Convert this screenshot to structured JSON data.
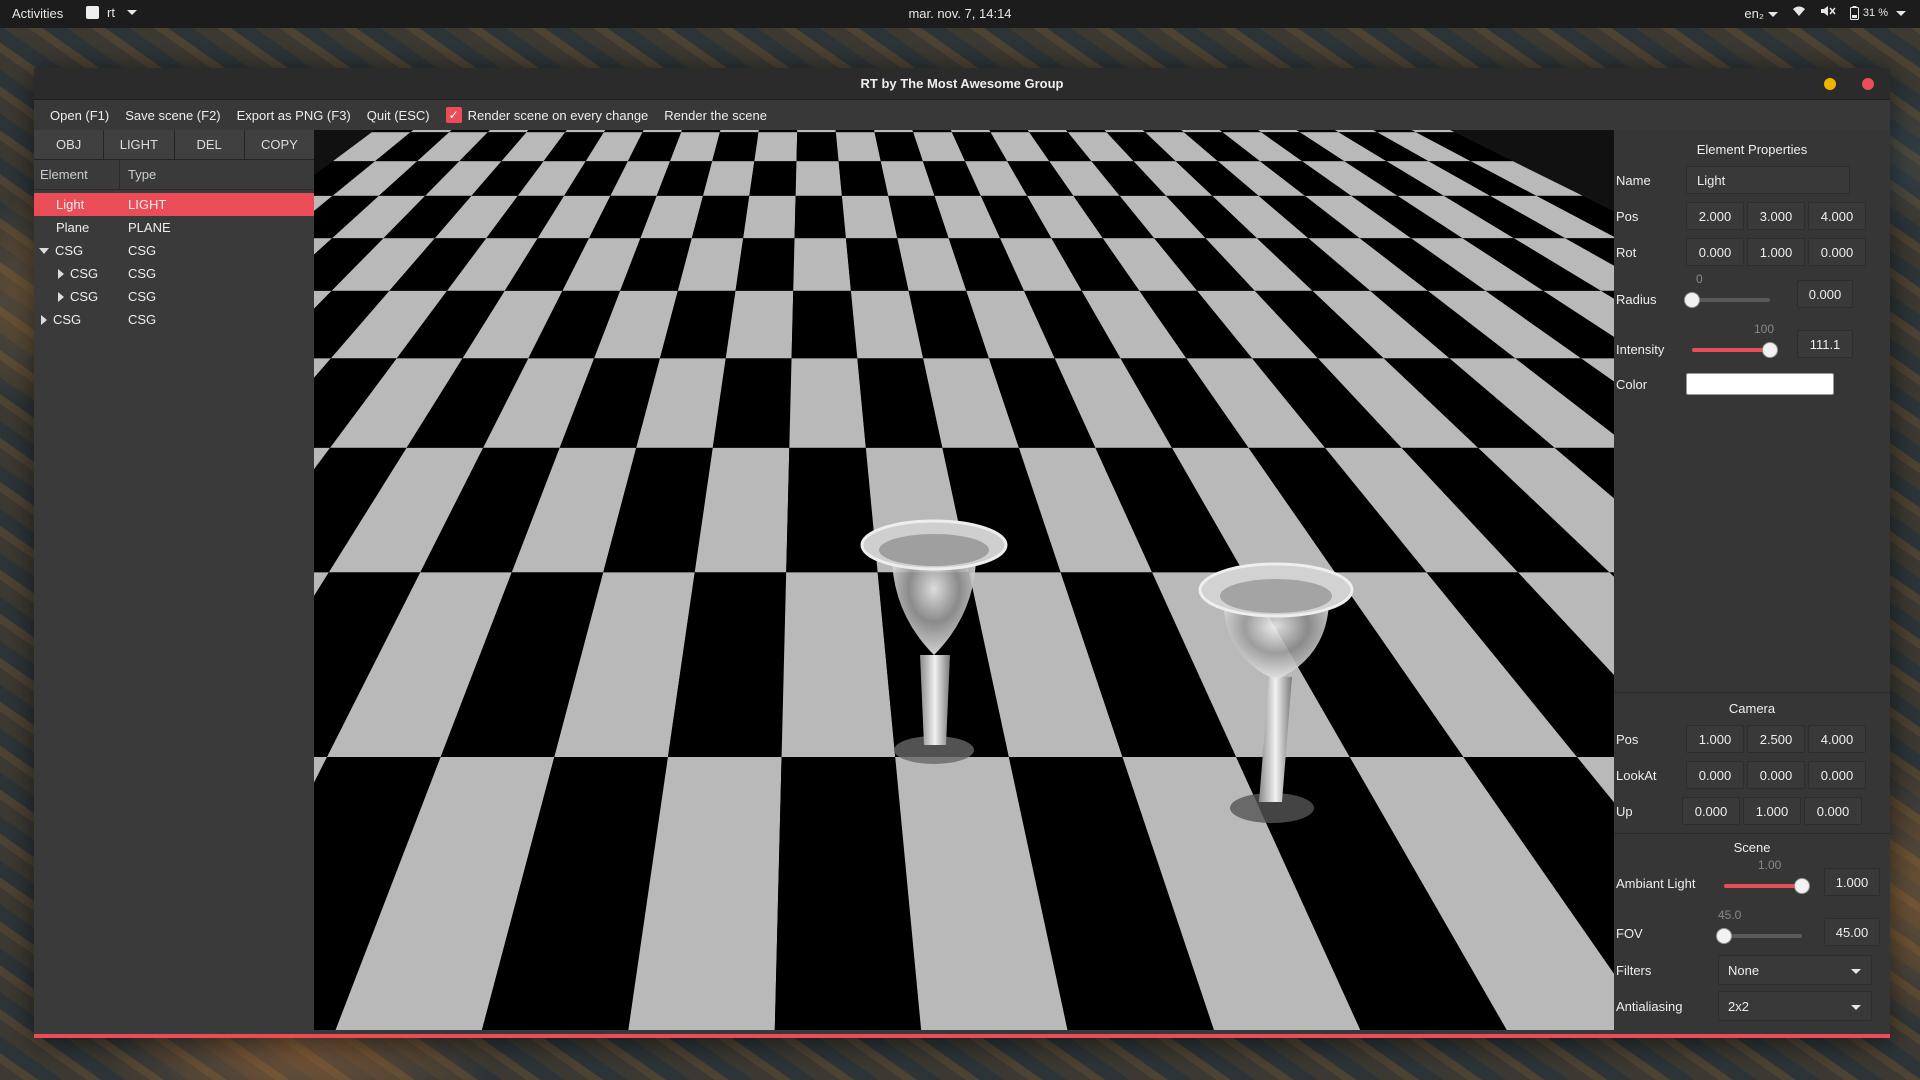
{
  "topbar": {
    "activities": "Activities",
    "app": "rt",
    "clock": "mar. nov.  7, 14:14",
    "lang": "en₂",
    "battery": "31 %"
  },
  "window": {
    "title": "RT by The Most Awesome Group"
  },
  "menu": {
    "open": "Open (F1)",
    "save": "Save scene (F2)",
    "export": "Export as PNG (F3)",
    "quit": "Quit (ESC)",
    "render_on_change": "Render scene on every change",
    "render_on_change_checked": true,
    "render": "Render the scene"
  },
  "left": {
    "tabs": [
      "OBJ",
      "LIGHT",
      "DEL",
      "COPY"
    ],
    "headers": {
      "element": "Element",
      "type": "Type"
    },
    "rows": [
      {
        "element": "Light",
        "type": "LIGHT"
      },
      {
        "element": "Plane",
        "type": "PLANE"
      },
      {
        "element": "CSG",
        "type": "CSG"
      },
      {
        "element": "CSG",
        "type": "CSG"
      },
      {
        "element": "CSG",
        "type": "CSG"
      },
      {
        "element": "CSG",
        "type": "CSG"
      }
    ]
  },
  "properties": {
    "title": "Element Properties",
    "name_label": "Name",
    "name_value": "Light",
    "pos_label": "Pos",
    "pos": [
      "2.000",
      "3.000",
      "4.000"
    ],
    "rot_label": "Rot",
    "rot": [
      "0.000",
      "1.000",
      "0.000"
    ],
    "radius_label": "Radius",
    "radius_slider_text": "0",
    "radius_value": "0.000",
    "radius_level": 0,
    "intensity_label": "Intensity",
    "intensity_slider_text": "100",
    "intensity_value": "111.1",
    "intensity_level": 1,
    "color_label": "Color",
    "color_value": "#ffffff"
  },
  "camera": {
    "title": "Camera",
    "pos_label": "Pos",
    "pos": [
      "1.000",
      "2.500",
      "4.000"
    ],
    "lookat_label": "LookAt",
    "lookat": [
      "0.000",
      "0.000",
      "0.000"
    ],
    "up_label": "Up",
    "up": [
      "0.000",
      "1.000",
      "0.000"
    ]
  },
  "scene": {
    "title": "Scene",
    "ambient_label": "Ambiant Light",
    "ambient_slider_text": "1.00",
    "ambient_value": "1.000",
    "ambient_level": 1,
    "fov_label": "FOV",
    "fov_slider_text": "45.0",
    "fov_value": "45.00",
    "fov_level": 0,
    "filters_label": "Filters",
    "filters_value": "None",
    "aa_label": "Antialiasing",
    "aa_value": "2x2"
  },
  "colors": {
    "accent": "#ea4d57",
    "minimize": "#f0b400"
  }
}
